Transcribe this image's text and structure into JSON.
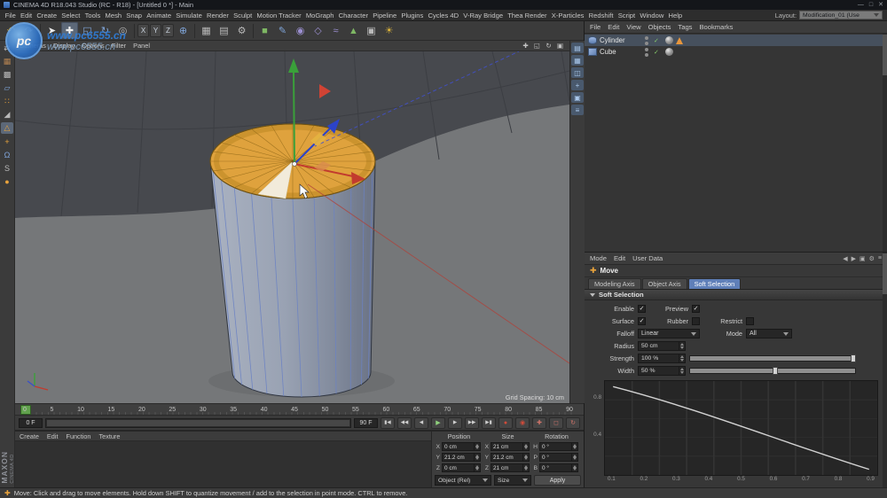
{
  "titlebar": {
    "title": "CINEMA 4D R18.043 Studio (RC - R18) - [Untitled 0 *] - Main",
    "minimize": "—",
    "maximize": "□",
    "close": "✕"
  },
  "menubar": {
    "items": [
      "File",
      "Edit",
      "Create",
      "Select",
      "Tools",
      "Mesh",
      "Snap",
      "Animate",
      "Simulate",
      "Render",
      "Sculpt",
      "Motion Tracker",
      "MoGraph",
      "Character",
      "Pipeline",
      "Plugins",
      "Cycles 4D",
      "V-Ray Bridge",
      "Thea Render",
      "X-Particles",
      "Redshift",
      "Script",
      "Window",
      "Help"
    ]
  },
  "layout": {
    "label": "Layout:",
    "value": "Modification_01 (Use"
  },
  "ui": {
    "check": "✓"
  },
  "toolbar": {
    "icons": [
      {
        "name": "undo",
        "glyph": "↶"
      },
      {
        "name": "redo",
        "glyph": "↷"
      },
      {
        "name": "live-selection",
        "glyph": "➤"
      },
      {
        "name": "move",
        "glyph": "✚"
      },
      {
        "name": "scale",
        "glyph": "◱"
      },
      {
        "name": "rotate",
        "glyph": "↻"
      },
      {
        "name": "last-tool",
        "glyph": "◎"
      },
      {
        "name": "lock-x",
        "glyph": "X"
      },
      {
        "name": "lock-y",
        "glyph": "Y"
      },
      {
        "name": "lock-z",
        "glyph": "Z"
      },
      {
        "name": "coordinate-system",
        "glyph": "⊕"
      },
      {
        "name": "render-view",
        "glyph": "▦"
      },
      {
        "name": "render-picture-viewer",
        "glyph": "▤"
      },
      {
        "name": "render-settings",
        "glyph": "⚙"
      },
      {
        "name": "add-primitive",
        "glyph": "■"
      },
      {
        "name": "add-spline",
        "glyph": "✎"
      },
      {
        "name": "add-subdivision",
        "glyph": "◉"
      },
      {
        "name": "add-generator",
        "glyph": "◇"
      },
      {
        "name": "add-deformer",
        "glyph": "≈"
      },
      {
        "name": "add-environment",
        "glyph": "▲"
      },
      {
        "name": "add-camera",
        "glyph": "▣"
      },
      {
        "name": "add-light",
        "glyph": "☀"
      }
    ]
  },
  "left_palette": {
    "icons": [
      {
        "name": "make-editable",
        "glyph": "⇄"
      },
      {
        "name": "model-mode",
        "glyph": "▦"
      },
      {
        "name": "texture-mode",
        "glyph": "▩"
      },
      {
        "name": "workplane-mode",
        "glyph": "▱"
      },
      {
        "name": "points-mode",
        "glyph": "∷"
      },
      {
        "name": "edges-mode",
        "glyph": "◢"
      },
      {
        "name": "polygons-mode",
        "glyph": "△"
      },
      {
        "name": "enable-axis",
        "glyph": "+"
      },
      {
        "name": "snap",
        "glyph": "Ω"
      },
      {
        "name": "viewport-solo",
        "glyph": "S"
      },
      {
        "name": "sculpt",
        "glyph": "●"
      }
    ]
  },
  "side_palette": {
    "icons": [
      {
        "name": "content-browser",
        "glyph": "▤"
      },
      {
        "name": "object-manager",
        "glyph": "▦"
      },
      {
        "name": "material-manager",
        "glyph": "◫"
      },
      {
        "name": "coordinates-panel",
        "glyph": "+"
      },
      {
        "name": "structure-panel",
        "glyph": "▣"
      },
      {
        "name": "console-panel",
        "glyph": "≡"
      }
    ]
  },
  "viewport": {
    "menu": [
      "Cameras",
      "Display",
      "Options",
      "Filter",
      "Panel"
    ],
    "nav": [
      {
        "name": "pan-view",
        "glyph": "✚"
      },
      {
        "name": "zoom-view",
        "glyph": "◱"
      },
      {
        "name": "rotate-view",
        "glyph": "↻"
      },
      {
        "name": "toggle-views",
        "glyph": "▣"
      }
    ],
    "grid_spacing": "Grid Spacing: 10 cm",
    "watermark": {
      "badge": "pc",
      "line1": "www.pc6555.cn",
      "line2": "www.pc6555.cn"
    }
  },
  "object_manager": {
    "menu": [
      "File",
      "Edit",
      "View",
      "Objects",
      "Tags",
      "Bookmarks"
    ],
    "objects": [
      {
        "label": "Cylinder"
      },
      {
        "label": "Cube"
      }
    ]
  },
  "attributes": {
    "menu": [
      "Mode",
      "Edit",
      "User Data"
    ],
    "tool_label": "Move",
    "tabs": [
      "Modeling Axis",
      "Object Axis",
      "Soft Selection"
    ],
    "section_title": "Soft Selection",
    "enable_label": "Enable",
    "preview_label": "Preview",
    "surface_label": "Surface",
    "rubber_label": "Rubber",
    "restrict_label": "Restrict",
    "falloff_label": "Falloff",
    "falloff_value": "Linear",
    "mode_label": "Mode",
    "mode_value": "All",
    "radius_label": "Radius",
    "radius_value": "50 cm",
    "strength_label": "Strength",
    "strength_value": "100 %",
    "width_label": "Width",
    "width_value": "50 %",
    "graph": {
      "y_labels": [
        "0.8",
        "0.4"
      ],
      "x_labels": [
        "0.1",
        "0.2",
        "0.3",
        "0.4",
        "0.5",
        "0.6",
        "0.7",
        "0.8",
        "0.9"
      ],
      "curve": "linear-falloff from 1.0 at x=0 to 0.0 at x=1"
    }
  },
  "timeline": {
    "frames": [
      "0",
      "5",
      "10",
      "15",
      "20",
      "25",
      "30",
      "35",
      "40",
      "45",
      "50",
      "55",
      "60",
      "65",
      "70",
      "75",
      "80",
      "85",
      "90"
    ]
  },
  "transport": {
    "start": "0 F",
    "end": "90 F",
    "buttons": [
      {
        "name": "goto-start",
        "glyph": "▮◀"
      },
      {
        "name": "prev-key",
        "glyph": "◀◀"
      },
      {
        "name": "prev-frame",
        "glyph": "◀"
      },
      {
        "name": "play",
        "glyph": "▶"
      },
      {
        "name": "next-frame",
        "glyph": "▶"
      },
      {
        "name": "next-key",
        "glyph": "▶▶"
      },
      {
        "name": "goto-end",
        "glyph": "▶▮"
      }
    ],
    "record": [
      {
        "name": "record-keyframe",
        "glyph": "●"
      },
      {
        "name": "autokey",
        "glyph": "◉"
      },
      {
        "name": "record-position",
        "glyph": "✚"
      },
      {
        "name": "record-scale",
        "glyph": "◻"
      },
      {
        "name": "record-rotation",
        "glyph": "↻"
      }
    ]
  },
  "materials": {
    "menu": [
      "Create",
      "Edit",
      "Function",
      "Texture"
    ]
  },
  "coordinates": {
    "headers": [
      "Position",
      "Size",
      "Rotation"
    ],
    "rows": [
      {
        "pl": "X",
        "pv": "0 cm",
        "sl": "X",
        "sv": "21 cm",
        "rl": "H",
        "rv": "0 °"
      },
      {
        "pl": "Y",
        "pv": "21.2 cm",
        "sl": "Y",
        "sv": "21.2 cm",
        "rl": "P",
        "rv": "0 °"
      },
      {
        "pl": "Z",
        "pv": "0 cm",
        "sl": "Z",
        "sv": "21 cm",
        "rl": "B",
        "rv": "0 °"
      }
    ],
    "mode_value": "Object (Rel)",
    "size_mode_value": "Size",
    "apply_label": "Apply"
  },
  "statusbar": {
    "message": "Move: Click and drag to move elements. Hold down SHIFT to quantize movement / add to the selection in point mode. CTRL to remove."
  },
  "branding": {
    "maxon": "MAXON",
    "cinema": "CINEMA 4D"
  },
  "colors": {
    "accent_orange": "#e8a33c",
    "tab_active_blue": "#5f7fb8",
    "gizmo_green": "#3aa03a",
    "gizmo_red": "#c23b2e",
    "gizmo_blue": "#2c43c8",
    "cap_orange": "#dfa23d",
    "watermark_blue": "#2f7cd6",
    "wireframe_blue": "#6b82c4"
  }
}
